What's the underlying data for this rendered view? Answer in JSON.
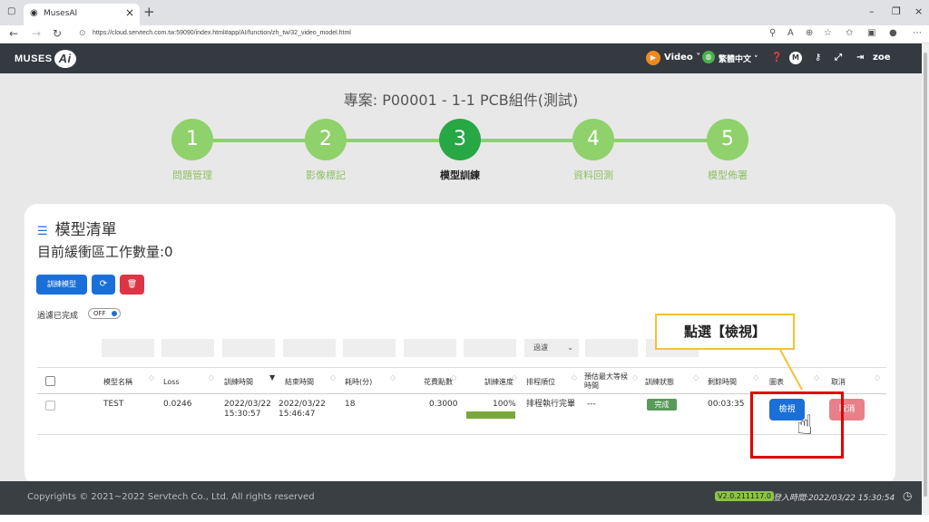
{
  "browser": {
    "tab_title": "MusesAI",
    "tab_close": "×",
    "new_tab": "+",
    "url": "https://cloud.servtech.com.tw:59090/index.html#app/AI/function/zh_tw/32_video_model.html",
    "window_controls": [
      "–",
      "❐",
      "×"
    ]
  },
  "header": {
    "logo_text": "MUSES",
    "logo_ai": "Ai",
    "video_label": "Video",
    "language_label": "繁體中文",
    "user_name": "zoe"
  },
  "project": {
    "title": "專案: P00001 - 1-1 PCB組件(測試)"
  },
  "steps": [
    {
      "num": "1",
      "label": "問題管理"
    },
    {
      "num": "2",
      "label": "影像標記"
    },
    {
      "num": "3",
      "label": "模型訓練"
    },
    {
      "num": "4",
      "label": "資料回測"
    },
    {
      "num": "5",
      "label": "模型佈署"
    }
  ],
  "panel": {
    "title": "模型清單",
    "buffer_text": "目前緩衝區工作數量:0",
    "train_button": "訓練模型",
    "filter_label": "過濾已完成",
    "toggle_label": "OFF",
    "filter_select": "過濾"
  },
  "table": {
    "headers": [
      "模型名稱",
      "Loss",
      "訓練時間",
      "結束時間",
      "耗時(分)",
      "花費點數",
      "訓練進度",
      "排程順位",
      "預估最大等候時間",
      "訓練狀態",
      "剩餘時間",
      "圖表",
      "取消"
    ],
    "row": {
      "name": "TEST",
      "loss": "0.0246",
      "train_time": "2022/03/22 15:30:57",
      "end_time": "2022/03/22 15:46:47",
      "duration": "18",
      "points": "0.3000",
      "progress_text": "100%",
      "progress": 1.0,
      "schedule": "排程執行完畢",
      "wait": "---",
      "status": "完成",
      "remaining": "00:03:35",
      "view_button": "檢視",
      "cancel_button": "取消"
    }
  },
  "annotation": {
    "callout": "點選【檢視】"
  },
  "footer": {
    "copyright": "Copyrights © 2021~2022 Servtech Co., Ltd. All rights reserved",
    "version": "V2.0.211117.0",
    "login_time": "登入時間:2022/03/22  15:30:54"
  },
  "colors": {
    "step_done": "#8fd16a",
    "step_active": "#28a745",
    "primary": "#1a6fd8",
    "danger": "#dc3545",
    "header_bg": "#343a40"
  }
}
